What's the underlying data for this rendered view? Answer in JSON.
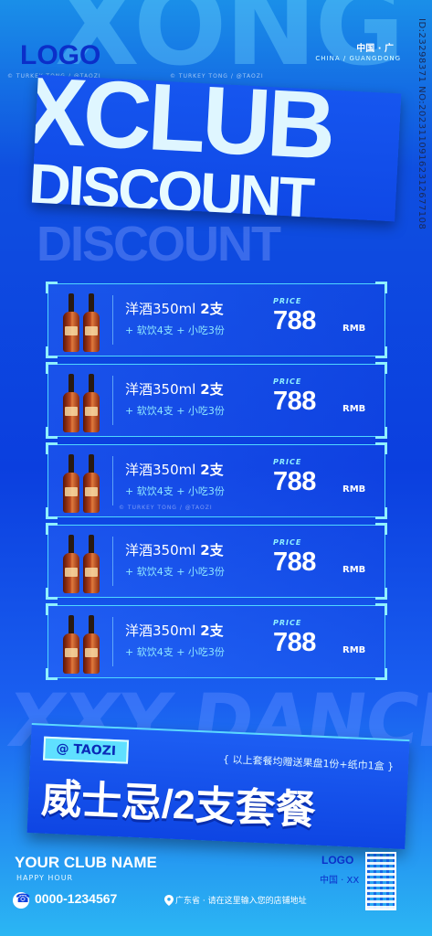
{
  "header": {
    "logo": "LOGO",
    "location": "中国 · 广",
    "location_sub": "CHINA / GUANGDONG",
    "side_id": "ID:23298371 NO:20231109162312677108",
    "watermark": "© TURKEY TONG / @TAOZI",
    "bg_word_top": "XONG",
    "banner_line1": "XCLUB",
    "banner_line2": "DISCOUNT",
    "ghost_line": "DISCOUNT"
  },
  "items": [
    {
      "name": "洋酒350ml",
      "qty": "2支",
      "extra": "+ 软饮4支 + 小吃3份",
      "price_label": "PRICE",
      "price": "788",
      "unit": "RMB"
    },
    {
      "name": "洋酒350ml",
      "qty": "2支",
      "extra": "+ 软饮4支 + 小吃3份",
      "price_label": "PRICE",
      "price": "788",
      "unit": "RMB"
    },
    {
      "name": "洋酒350ml",
      "qty": "2支",
      "extra": "+ 软饮4支 + 小吃3份",
      "price_label": "PRICE",
      "price": "788",
      "unit": "RMB"
    },
    {
      "name": "洋酒350ml",
      "qty": "2支",
      "extra": "+ 软饮4支 + 小吃3份",
      "price_label": "PRICE",
      "price": "788",
      "unit": "RMB"
    },
    {
      "name": "洋酒350ml",
      "qty": "2支",
      "extra": "+ 软饮4支 + 小吃3份",
      "price_label": "PRICE",
      "price": "788",
      "unit": "RMB"
    }
  ],
  "promo": {
    "bg_word": "XXY DANCE C",
    "tag": "@ TAOZI",
    "note": "{ 以上套餐均赠送果盘1份+纸巾1盒 }",
    "headline": "威士忌/2支套餐"
  },
  "footer": {
    "club_name": "YOUR CLUB NAME",
    "happy_hour": "HAPPY HOUR",
    "phone": "0000-1234567",
    "address": "广东省 · 请在这里输入您的店铺地址",
    "logo": "LOGO",
    "country": "中国 · XX"
  },
  "colors": {
    "primary": "#0f48e6",
    "accent": "#4fd6ff",
    "logo": "#0b2fc9"
  }
}
